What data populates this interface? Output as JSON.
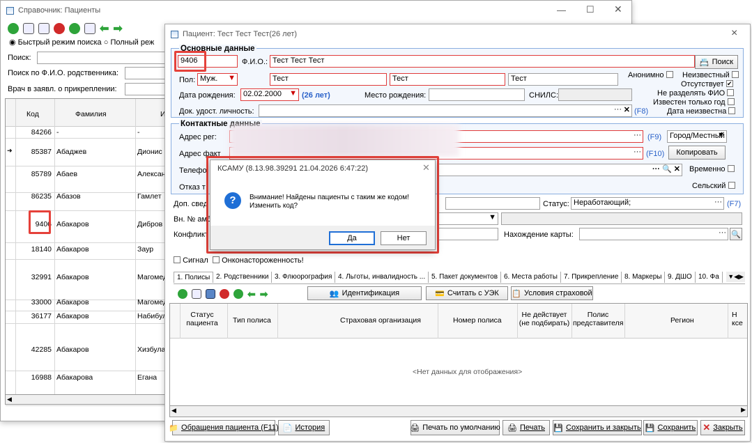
{
  "back_window": {
    "title": "Справочник: Пациенты",
    "radio_fast": "Быстрый режим поиска",
    "radio_full": "Полный реж",
    "search_label": "Поиск:",
    "relative_label": "Поиск по Ф.И.О. родственника:",
    "doctor_label": "Врач в заявл. о прикреплении:",
    "col_code": "Код",
    "col_surname": "Фамилия",
    "col_name": "И",
    "rows": [
      {
        "code": "84266",
        "surname": "-",
        "name": "-"
      },
      {
        "code": "85387",
        "surname": "Абаджев",
        "name": "Дионис"
      },
      {
        "code": "85789",
        "surname": "Абаев",
        "name": "Александ"
      },
      {
        "code": "86235",
        "surname": "Абазов",
        "name": "Гамлет"
      },
      {
        "code": "9406",
        "surname": "Абакаров",
        "name": "Дибров"
      },
      {
        "code": "18140",
        "surname": "Абакаров",
        "name": "Заур"
      },
      {
        "code": "32991",
        "surname": "Абакаров",
        "name": "Магомед-"
      },
      {
        "code": "33000",
        "surname": "Абакаров",
        "name": "Магомед-"
      },
      {
        "code": "36177",
        "surname": "Абакаров",
        "name": "Набибула"
      },
      {
        "code": "42285",
        "surname": "Абакаров",
        "name": "Хизбула"
      },
      {
        "code": "16988",
        "surname": "Абакарова",
        "name": "Егана"
      }
    ]
  },
  "patient_window": {
    "title": "Пациент: Тест Тест Тест(26 лет)",
    "close": "×",
    "main_group": "Основные данные",
    "code_value": "9406",
    "fio_label": "Ф.И.О.:",
    "fio_value": "Тест Тест Тест",
    "search_btn": "Поиск",
    "sex_label": "Пол:",
    "sex_value": "Муж.",
    "name1": "Тест",
    "name2": "Тест",
    "name3": "Тест",
    "anon_label": "Анонимно",
    "unknown_label": "Неизвестный",
    "absent_label": "Отсутствует",
    "nosplit_label": "Не разделять ФИО",
    "yearonly_label": "Известен только год",
    "dateunknown_label": "Дата неизвестна",
    "dob_label": "Дата рождения:",
    "dob_value": "02.02.2000",
    "age": "(26 лет)",
    "birthplace_label": "Место рождения:",
    "snils_label": "СНИЛС:",
    "doc_label": "Док. удост. личность:",
    "f8": "(F8)",
    "contact_group": "Контактные данные",
    "addr_reg_label": "Адрес рег:",
    "addr_fact_label": "Адрес факт",
    "f9": "(F9)",
    "f10": "(F10)",
    "city_value": "Город/Местный",
    "copy_btn": "Копировать",
    "phone_label": "Телефо",
    "temp_label": "Временно",
    "refuse_label": "Отказ т",
    "rural_label": "Сельский",
    "extra_label": "Доп. свед",
    "status_label": "Статус:",
    "status_value": "Неработающий;",
    "f7": "(F7)",
    "amb_label": "Вн. № амб",
    "conflict_label": "Конфликт",
    "card_label": "Нахождение карты:",
    "signal_label": "Сигнал",
    "onco_label": "Онконастороженность!",
    "tabs": [
      "1. Полисы",
      "2. Родственники",
      "3. Флюорография",
      "4. Льготы, инвалидность ...",
      "5. Пакет документов",
      "6. Места работы",
      "7. Прикрепление",
      "8. Маркеры",
      "9. ДШО",
      "10. Фа"
    ],
    "ident_btn": "Идентификация",
    "uek_btn": "Считать с УЭК",
    "insurance_btn": "Условия страховой",
    "cols": [
      "Статус пациента",
      "Тип полиса",
      "Страховая организация",
      "Номер полиса",
      "Не действует (не подбирать)",
      "Полис представителя",
      "Регион",
      "Н ксе"
    ],
    "empty": "<Нет данных для отображения>",
    "btn_visits": "Обращения пациента (F11)",
    "btn_history": "История",
    "btn_print_default": "Печать по умолчанию",
    "btn_print": "Печать",
    "btn_save_close": "Сохранить и закрыть",
    "btn_save": "Сохранить",
    "btn_close": "Закрыть"
  },
  "dialog": {
    "title": "КСАМУ (8.13.98.39291 21.04.2026 6:47:22)",
    "line1": "Внимание! Найдены пациенты с таким же кодом!",
    "line2": "Изменить код?",
    "yes": "Да",
    "no": "Нет"
  },
  "colors": {
    "highlight": "#e5413a",
    "group_border": "#8aaee0",
    "blue_text": "#2a62c9",
    "dialog_btn": "#1f6fd6"
  }
}
